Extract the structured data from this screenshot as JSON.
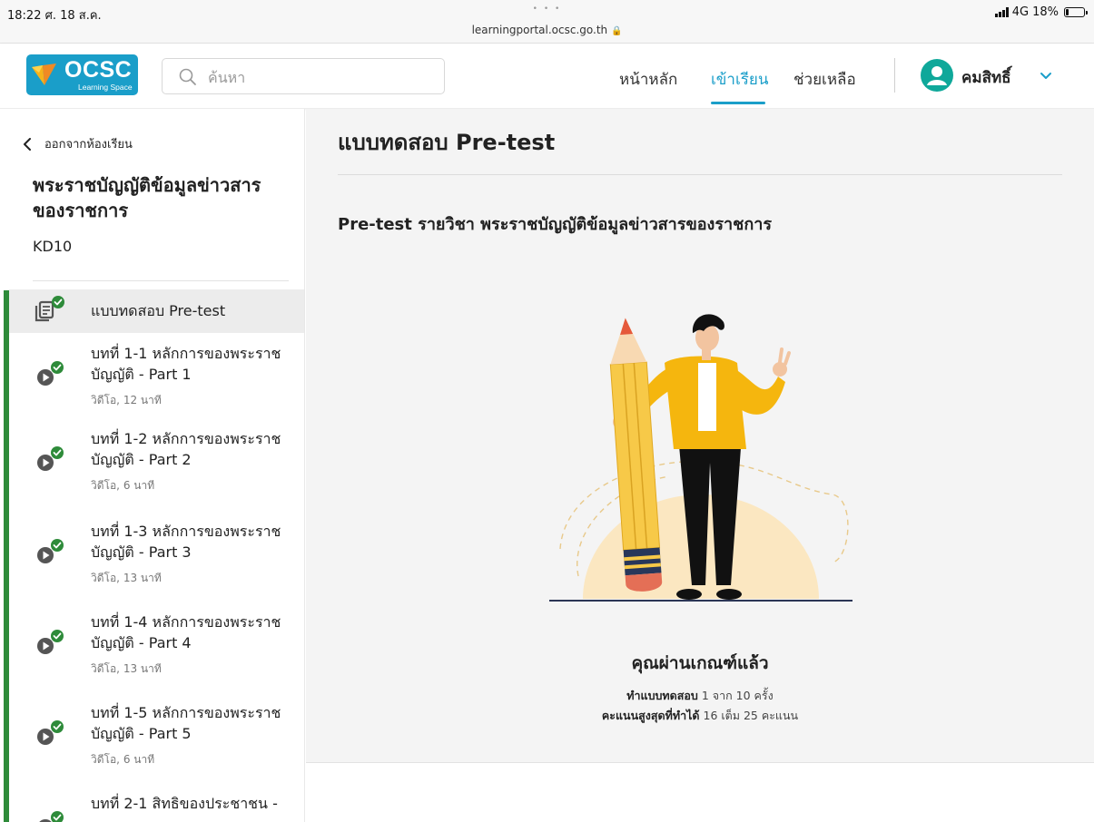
{
  "status_bar": {
    "time": "18:22 ศ. 18 ส.ค.",
    "dots": "• • •",
    "url": "learningportal.ocsc.go.th",
    "network": "4G",
    "battery": "18%",
    "battery_level": 0.18
  },
  "header": {
    "logo_text": "OCSC",
    "logo_subtext": "Learning Space",
    "search_placeholder": "ค้นหา",
    "nav": {
      "home": "หน้าหลัก",
      "learn": "เข้าเรียน",
      "help": "ช่วยเหลือ"
    },
    "user_name": "คมสิทธิ์",
    "accent_color": "#1a9ec9"
  },
  "sidebar": {
    "back_label": "ออกจากห้องเรียน",
    "course_title": "พระราชบัญญัติข้อมูลข่าวสารของราชการ",
    "course_code": "KD10",
    "progress_color": "#2e8b3a",
    "items": [
      {
        "title": "แบบทดสอบ Pre-test",
        "meta": "",
        "icon": "quiz-icon",
        "status": "completed",
        "active": true
      },
      {
        "title": "บทที่ 1-1 หลักการของพระราชบัญญัติ - Part 1",
        "meta": "วิดีโอ, 12 นาที",
        "icon": "video-icon",
        "status": "completed"
      },
      {
        "title": "บทที่ 1-2 หลักการของพระราชบัญญัติ - Part 2",
        "meta": "วิดีโอ, 6 นาที",
        "icon": "video-icon",
        "status": "completed"
      },
      {
        "title": "บทที่ 1-3 หลักการของพระราชบัญญัติ - Part 3",
        "meta": "วิดีโอ, 13 นาที",
        "icon": "video-icon",
        "status": "completed"
      },
      {
        "title": "บทที่ 1-4 หลักการของพระราชบัญญัติ - Part 4",
        "meta": "วิดีโอ, 13 นาที",
        "icon": "video-icon",
        "status": "completed"
      },
      {
        "title": "บทที่ 1-5 หลักการของพระราชบัญญัติ - Part 5",
        "meta": "วิดีโอ, 6 นาที",
        "icon": "video-icon",
        "status": "completed"
      },
      {
        "title": "บทที่ 2-1 สิทธิของประชาชน -",
        "meta": "",
        "icon": "video-icon",
        "status": "completed"
      }
    ]
  },
  "main": {
    "title": "แบบทดสอบ Pre-test",
    "subtitle": "Pre-test รายวิชา พระราชบัญญัติข้อมูลข่าวสารของราชการ",
    "pass_title": "คุณผ่านเกณฑ์แล้ว",
    "attempts_label": "ทำแบบทดสอบ",
    "attempts_value": "1 จาก 10 ครั้ง",
    "score_label": "คะแนนสูงสุดที่ทำได้",
    "score_value": "16 เต็ม 25 คะแนน"
  }
}
